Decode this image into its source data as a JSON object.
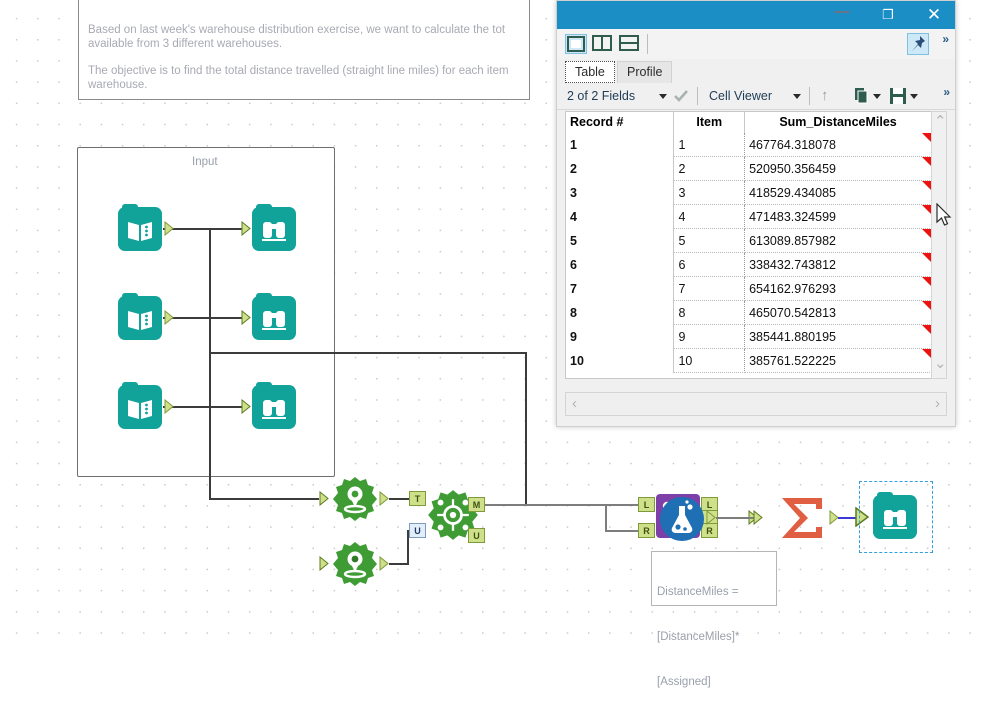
{
  "canvas": {
    "comment": {
      "line1": "Based on last week's warehouse distribution exercise, we want to calculate the tot",
      "line2": "available from 3 different warehouses.",
      "line3": "The objective is to find the total distance travelled (straight line miles) for each item",
      "line4": "warehouse."
    },
    "container": {
      "title": "Input"
    },
    "tools": {
      "input_1": "input-data-tool",
      "input_2": "input-data-tool",
      "input_3": "input-data-tool",
      "browse_1": "browse-tool",
      "browse_2": "browse-tool",
      "browse_3": "browse-tool",
      "create_points_1": "create-points-tool",
      "create_points_2": "create-points-tool",
      "find_nearest": "find-nearest-tool",
      "join": "join-tool",
      "formula": "formula-tool",
      "summarize": "summarize-tool",
      "browse_final": "browse-tool"
    },
    "anchors": {
      "find_nearest_in_t": "T",
      "find_nearest_in_u": "U",
      "find_nearest_out_m": "M",
      "find_nearest_out_u": "U",
      "join_in_l": "L",
      "join_in_r": "R",
      "join_out_l": "L",
      "join_out_j": "J",
      "join_out_r": "R"
    },
    "annotation": {
      "line1": "DistanceMiles =",
      "line2": "[DistanceMiles]*",
      "line3": "[Assigned]"
    },
    "colors": {
      "tool_teal": "#11a29a",
      "tool_green": "#3f9c35",
      "tool_purple": "#7d3fa8",
      "tool_blue": "#1f6fb5",
      "tool_orange": "#e05e42",
      "selection": "#2f9fe0"
    }
  },
  "results_window": {
    "titlebar": {
      "minimize_label": "—",
      "maximize_label": "❐",
      "close_label": "✕"
    },
    "iconbar": {
      "layout_single": "layout-single-icon",
      "layout_vertical": "layout-vertical-split-icon",
      "layout_horizontal": "layout-horizontal-split-icon",
      "pin": "pin-icon",
      "overflow": "»"
    },
    "tabs": [
      {
        "label": "Table",
        "active": true
      },
      {
        "label": "Profile",
        "active": false
      }
    ],
    "toolbar": {
      "fields_label": "2 of 2 Fields",
      "check_icon": "checkmark-icon",
      "viewer_label": "Cell Viewer",
      "up_icon": "↑",
      "copy_icon": "copy-icon",
      "save_icon": "save-icon",
      "overflow": "»"
    },
    "table": {
      "columns": [
        "Record #",
        "Item",
        "Sum_DistanceMiles"
      ],
      "rows": [
        {
          "record": "1",
          "item": "1",
          "sum": "467764.318078"
        },
        {
          "record": "2",
          "item": "2",
          "sum": "520950.356459"
        },
        {
          "record": "3",
          "item": "3",
          "sum": "418529.434085"
        },
        {
          "record": "4",
          "item": "4",
          "sum": "471483.324599"
        },
        {
          "record": "5",
          "item": "5",
          "sum": "613089.857982"
        },
        {
          "record": "6",
          "item": "6",
          "sum": "338432.743812"
        },
        {
          "record": "7",
          "item": "7",
          "sum": "654162.976293"
        },
        {
          "record": "8",
          "item": "8",
          "sum": "465070.542813"
        },
        {
          "record": "9",
          "item": "9",
          "sum": "385441.880195"
        },
        {
          "record": "10",
          "item": "10",
          "sum": "385761.522225"
        }
      ]
    },
    "scroll": {
      "up_arrow": "⌃",
      "down_arrow": "⌄",
      "left_arrow": "‹",
      "right_arrow": "›"
    }
  }
}
